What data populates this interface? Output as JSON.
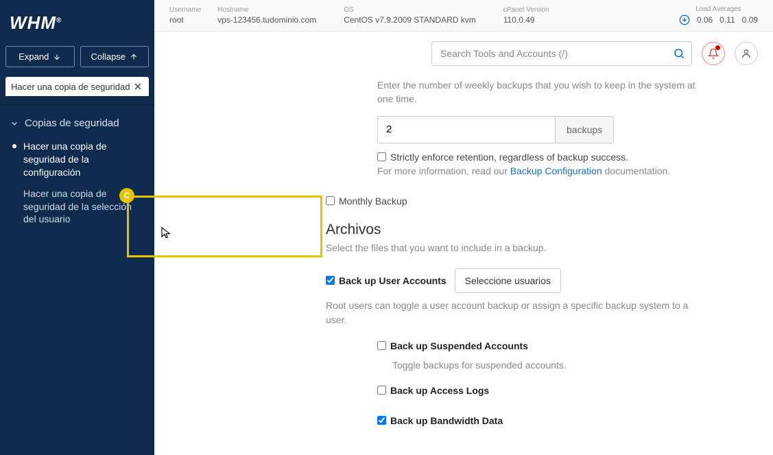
{
  "topbar": {
    "username_label": "Username",
    "username": "root",
    "hostname_label": "Hostname",
    "hostname": "vps-123456.tudominio.com",
    "os_label": "OS",
    "os": "CentOS v7.9.2009 STANDARD kvm",
    "cpv_label": "cPanel Version",
    "cpv": "110.0.49",
    "load_label": "Load Averages",
    "load1": "0.06",
    "load5": "0.11",
    "load15": "0.09"
  },
  "logo": "WHM",
  "buttons": {
    "expand": "Expand",
    "collapse": "Collapse"
  },
  "tab": "Hacer una copia de seguridad",
  "nav": {
    "group": "Copias de seguridad",
    "items": [
      "Hacer una copia de seguridad de la configuración",
      "Hacer una copia de seguridad de la selección del usuario"
    ]
  },
  "search_placeholder": "Search Tools and Accounts (/)",
  "weekly": {
    "desc": "Enter the number of weekly backups that you wish to keep in the system at one time.",
    "value": "2",
    "suffix": "backups",
    "strict_label": "Strictly enforce retention, regardless of backup success.",
    "info_prefix": "For more information, read our ",
    "info_link": "Backup Configuration",
    "info_suffix": " documentation."
  },
  "monthly": "Monthly Backup",
  "files": {
    "heading": "Archivos",
    "desc": "Select the files that you want to include in a backup.",
    "user_accounts": "Back up User Accounts",
    "select_users_btn": "Seleccione usuarios",
    "root_note": "Root users can toggle a user account backup or assign a specific backup system to a user.",
    "suspended": "Back up Suspended Accounts",
    "suspended_desc": "Toggle backups for suspended accounts.",
    "access_logs": "Back up Access Logs",
    "bandwidth": "Back up Bandwidth Data"
  },
  "callout_letter": "C"
}
